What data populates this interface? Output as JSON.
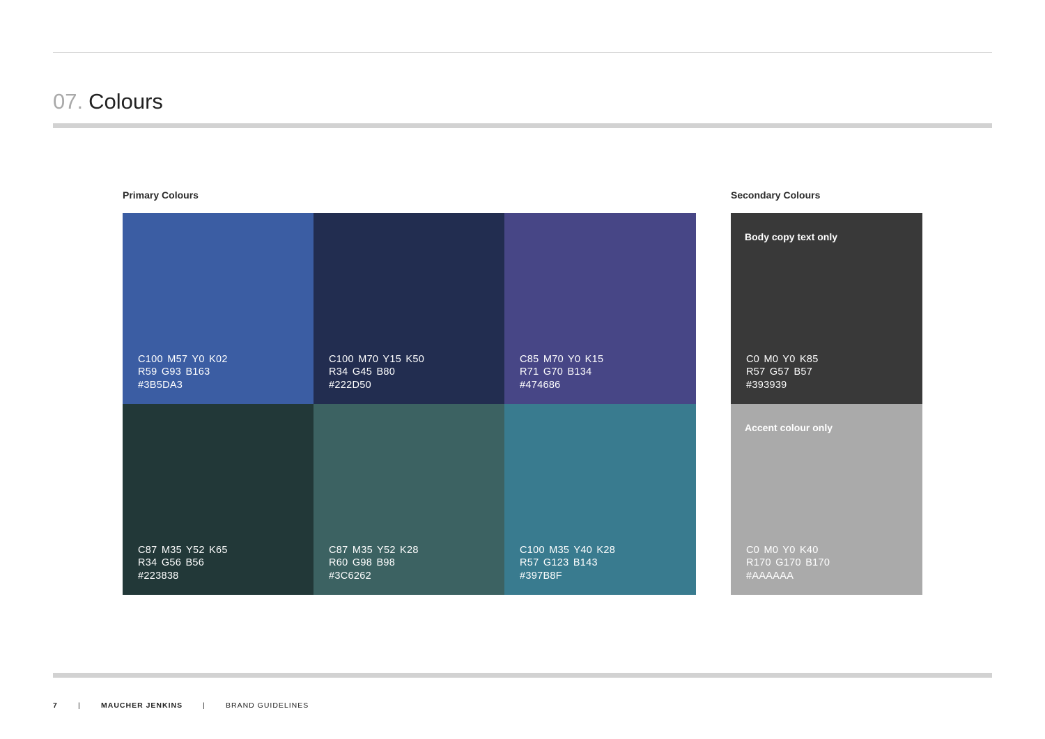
{
  "header": {
    "section_number": "07.",
    "title": "Colours"
  },
  "primary": {
    "label": "Primary Colours",
    "swatches": [
      {
        "color": "#3B5DA3",
        "cmyk": "C100 M57 Y0 K02",
        "rgb": "R59 G93 B163",
        "hex": "#3B5DA3"
      },
      {
        "color": "#222D50",
        "cmyk": "C100 M70 Y15 K50",
        "rgb": "R34 G45 B80",
        "hex": "#222D50"
      },
      {
        "color": "#474686",
        "cmyk": "C85 M70 Y0 K15",
        "rgb": "R71 G70 B134",
        "hex": "#474686"
      },
      {
        "color": "#223838",
        "cmyk": "C87 M35 Y52 K65",
        "rgb": "R34 G56 B56",
        "hex": "#223838"
      },
      {
        "color": "#3C6262",
        "cmyk": "C87 M35 Y52 K28",
        "rgb": "R60 G98 B98",
        "hex": "#3C6262"
      },
      {
        "color": "#397B8F",
        "cmyk": "C100 M35 Y40 K28",
        "rgb": "R57 G123 B143",
        "hex": "#397B8F"
      }
    ]
  },
  "secondary": {
    "label": "Secondary Colours",
    "swatches": [
      {
        "color": "#393939",
        "note": "Body copy text only",
        "cmyk": "C0 M0 Y0 K85",
        "rgb": "R57 G57 B57",
        "hex": "#393939"
      },
      {
        "color": "#AAAAAA",
        "note": "Accent colour only",
        "cmyk": "C0 M0 Y0 K40",
        "rgb": "R170 G170 B170",
        "hex": "#AAAAAA"
      }
    ]
  },
  "footer": {
    "page_number": "7",
    "separator": "|",
    "company": "MAUCHER JENKINS",
    "document": "BRAND GUIDELINES"
  }
}
